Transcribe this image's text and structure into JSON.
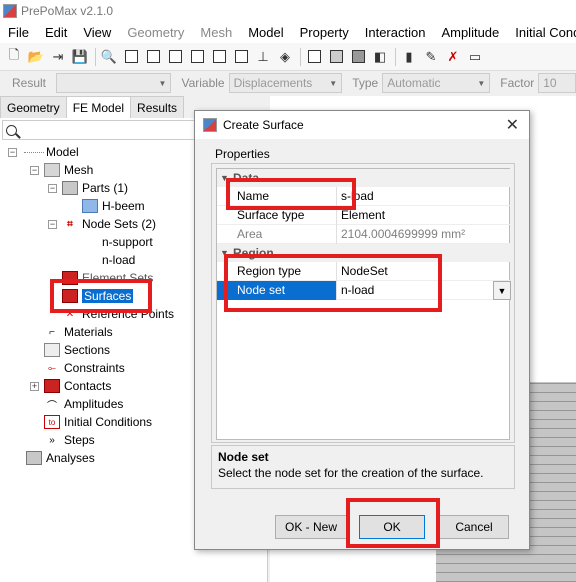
{
  "app": {
    "title": "PrePoMax v2.1.0"
  },
  "menu": [
    {
      "label": "File",
      "disabled": false
    },
    {
      "label": "Edit",
      "disabled": false
    },
    {
      "label": "View",
      "disabled": false
    },
    {
      "label": "Geometry",
      "disabled": true
    },
    {
      "label": "Mesh",
      "disabled": true
    },
    {
      "label": "Model",
      "disabled": false
    },
    {
      "label": "Property",
      "disabled": false
    },
    {
      "label": "Interaction",
      "disabled": false
    },
    {
      "label": "Amplitude",
      "disabled": false
    },
    {
      "label": "Initial Cond",
      "disabled": false
    }
  ],
  "resultbar": {
    "result_label": "Result",
    "variable_label": "Variable",
    "variable_value": "Displacements",
    "type_label": "Type",
    "type_value": "Automatic",
    "factor_label": "Factor",
    "factor_value": "10"
  },
  "tabs": [
    "Geometry",
    "FE Model",
    "Results"
  ],
  "active_tab": "FE Model",
  "tree": {
    "model": "Model",
    "mesh": "Mesh",
    "parts": "Parts (1)",
    "part_h": "H-beem",
    "node_sets": "Node Sets (2)",
    "ns_support": "n-support",
    "ns_load": "n-load",
    "element_sets": "Element Sets",
    "surfaces": "Surfaces",
    "reference_points": "Reference Points",
    "materials": "Materials",
    "sections": "Sections",
    "constraints": "Constraints",
    "contacts": "Contacts",
    "amplitudes": "Amplitudes",
    "initial_conditions": "Initial Conditions",
    "steps": "Steps",
    "analyses": "Analyses"
  },
  "dialog": {
    "title": "Create Surface",
    "group_label": "Properties",
    "cat_data": "Data",
    "cat_region": "Region",
    "rows": {
      "name_label": "Name",
      "name_value": "s-load",
      "surface_type_label": "Surface type",
      "surface_type_value": "Element",
      "area_label": "Area",
      "area_value": "2104.0004699999 mm²",
      "region_type_label": "Region type",
      "region_type_value": "NodeSet",
      "node_set_label": "Node set",
      "node_set_value": "n-load"
    },
    "desc_title": "Node set",
    "desc_text": "Select the node set for the creation of the surface.",
    "buttons": {
      "ok_new": "OK - New",
      "ok": "OK",
      "cancel": "Cancel"
    }
  },
  "colors": {
    "highlight": "#e41e1e",
    "selection": "#0a6ed1"
  }
}
